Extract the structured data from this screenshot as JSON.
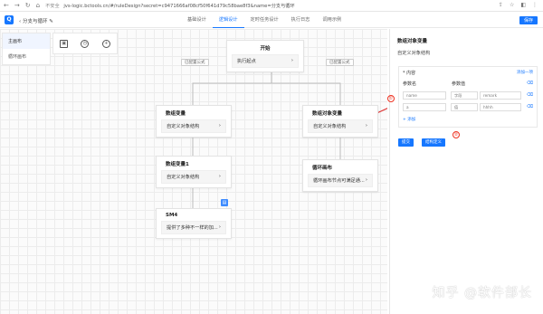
{
  "browser": {
    "nav_icons": [
      "back-icon",
      "forward-icon",
      "reload-icon",
      "home-icon"
    ],
    "security": "不安全",
    "url": "jvs-logic.bctools.cn/#/ruleDesign?secret=c9471666af08cf50f641d79c58bae8f3&name=分支与循环"
  },
  "app": {
    "title": "分支与循环",
    "tabs": [
      {
        "label": "基础设计",
        "active": false
      },
      {
        "label": "逻辑设计",
        "active": true
      },
      {
        "label": "定时任务设计",
        "active": false
      },
      {
        "label": "执行日志",
        "active": false
      },
      {
        "label": "调用示例",
        "active": false
      }
    ],
    "save_label": "保存",
    "accent": "#1677ff"
  },
  "canvas": {
    "layers": [
      {
        "label": "主画布",
        "active": true
      },
      {
        "label": "循环画布",
        "active": false
      }
    ],
    "tools": [
      "box-icon",
      "clock-icon",
      "plus-circle-icon"
    ],
    "nodes": {
      "start": {
        "title": "开始",
        "body": "执行起点"
      },
      "var_left": {
        "title": "数组变量",
        "body": "自定义对象结构"
      },
      "var_left2": {
        "title": "数组变量1",
        "body": "自定义对象结构"
      },
      "sm4": {
        "title": "SM4",
        "body": "提供了多种不一样的加..."
      },
      "var_right": {
        "title": "数组对象变量",
        "body": "自定义对象结构"
      },
      "loop": {
        "title": "循环画布",
        "body": "循环画布节点可满足通..."
      }
    },
    "edge_labels": [
      "已配置公式",
      "已配置公式"
    ]
  },
  "panel": {
    "title": "数组对象变量",
    "subtitle": "自定义对象结构",
    "section": "* 内容",
    "section_action": "添加一项",
    "col_name": "参数名",
    "col_value": "参数值",
    "rows": [
      {
        "name": "name",
        "type": "字段",
        "value": "remark"
      },
      {
        "name": "a",
        "type": "值",
        "value": "hhhh"
      }
    ],
    "add_label": "+ 添加",
    "btn_submit": "提交",
    "btn_define": "结构定义",
    "markers": [
      "①",
      "②"
    ]
  },
  "watermark": "知乎 @软件部长"
}
